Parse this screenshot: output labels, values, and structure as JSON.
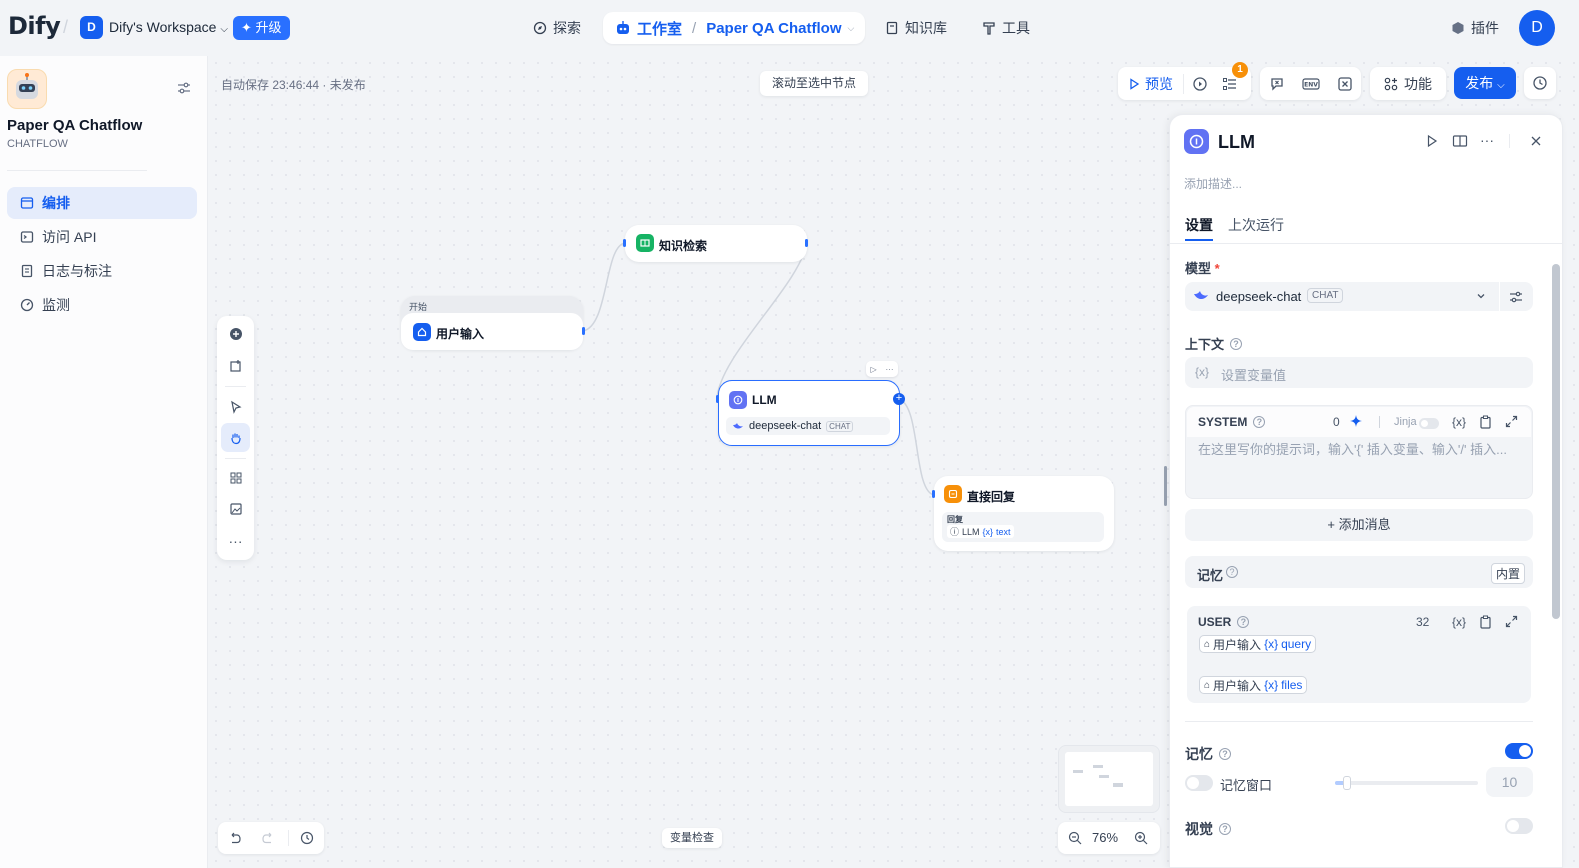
{
  "topbar": {
    "logo": "Dify",
    "workspace_initial": "D",
    "workspace_name": "Dify's Workspace",
    "upgrade_label": "升级",
    "nav_explore": "探索",
    "nav_studio": "工作室",
    "nav_app": "Paper QA Chatflow",
    "nav_knowledge": "知识库",
    "nav_tools": "工具",
    "plugins_label": "插件",
    "user_initial": "D"
  },
  "sidebar": {
    "app_title": "Paper QA Chatflow",
    "app_type": "CHATFLOW",
    "items": [
      {
        "label": "编排",
        "icon": "layout-icon",
        "active": true
      },
      {
        "label": "访问 API",
        "icon": "terminal-icon",
        "active": false
      },
      {
        "label": "日志与标注",
        "icon": "file-list-icon",
        "active": false
      },
      {
        "label": "监测",
        "icon": "gauge-icon",
        "active": false
      }
    ]
  },
  "canvas": {
    "autosave": "自动保存 23:46:44 · 未发布",
    "scroll_to_node": "滚动至选中节点",
    "preview_label": "预览",
    "checklist_badge": "1",
    "features_label": "功能",
    "publish_label": "发布",
    "var_inspect": "变量检查",
    "zoom": "76%",
    "nodes": {
      "start_group": "开始",
      "start_title": "用户输入",
      "knowledge_title": "知识检索",
      "llm_title": "LLM",
      "llm_model": "deepseek-chat",
      "llm_model_tag": "CHAT",
      "answer_title": "直接回复",
      "answer_label": "回复",
      "answer_var_node": "LLM",
      "answer_var_name": "text"
    }
  },
  "panel": {
    "title": "LLM",
    "desc_placeholder": "添加描述...",
    "tab_settings": "设置",
    "tab_last_run": "上次运行",
    "model_label": "模型",
    "model_name": "deepseek-chat",
    "model_tag": "CHAT",
    "context_label": "上下文",
    "context_placeholder": "设置变量值",
    "system_label": "SYSTEM",
    "system_count": "0",
    "jinja_label": "Jinja",
    "system_placeholder": "在这里写你的提示词，输入'{' 插入变量、输入'/' 插入...",
    "add_message": "+ 添加消息",
    "memory_inline_label": "记忆",
    "builtin_label": "内置",
    "user_label": "USER",
    "user_count": "32",
    "user_vars": [
      {
        "node": "用户输入",
        "var": "query"
      },
      {
        "node": "用户输入",
        "var": "files"
      }
    ],
    "memory_label": "记忆",
    "memory_window_label": "记忆窗口",
    "memory_window_value": "10",
    "vision_label": "视觉"
  }
}
